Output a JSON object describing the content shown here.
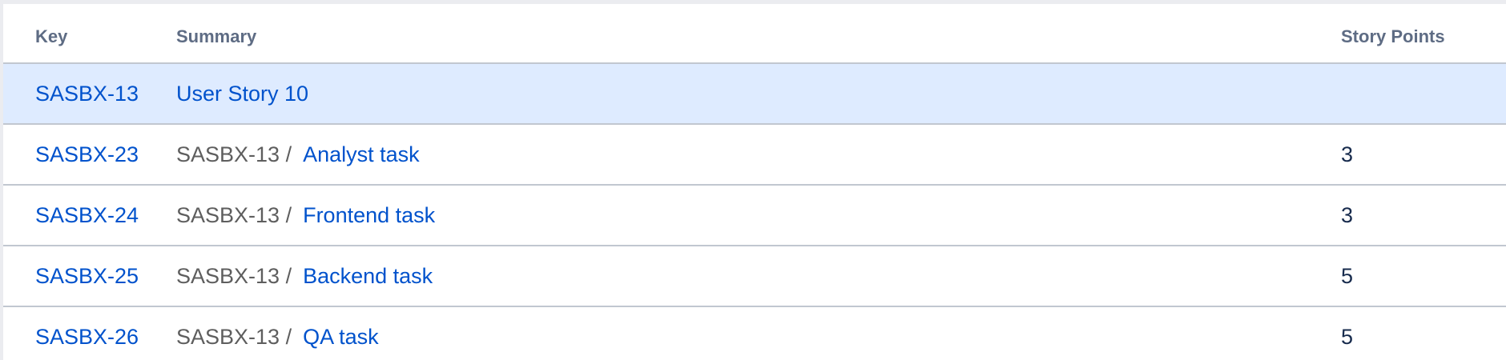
{
  "table": {
    "headers": {
      "key": "Key",
      "summary": "Summary",
      "story_points": "Story Points"
    },
    "rows": [
      {
        "key": "SASBX-13",
        "parent": "",
        "summary": "User Story 10",
        "story_points": "",
        "highlighted": true
      },
      {
        "key": "SASBX-23",
        "parent": "SASBX-13 /",
        "summary": "Analyst task",
        "story_points": "3",
        "highlighted": false
      },
      {
        "key": "SASBX-24",
        "parent": "SASBX-13 /",
        "summary": "Frontend task",
        "story_points": "3",
        "highlighted": false
      },
      {
        "key": "SASBX-25",
        "parent": "SASBX-13 /",
        "summary": "Backend task",
        "story_points": "5",
        "highlighted": false
      },
      {
        "key": "SASBX-26",
        "parent": "SASBX-13 /",
        "summary": "QA task",
        "story_points": "5",
        "highlighted": false
      }
    ]
  },
  "colors": {
    "link": "#0052cc",
    "highlight_row": "#deebff",
    "header_text": "#5e6c84",
    "parent_text": "#5e5e5e"
  }
}
